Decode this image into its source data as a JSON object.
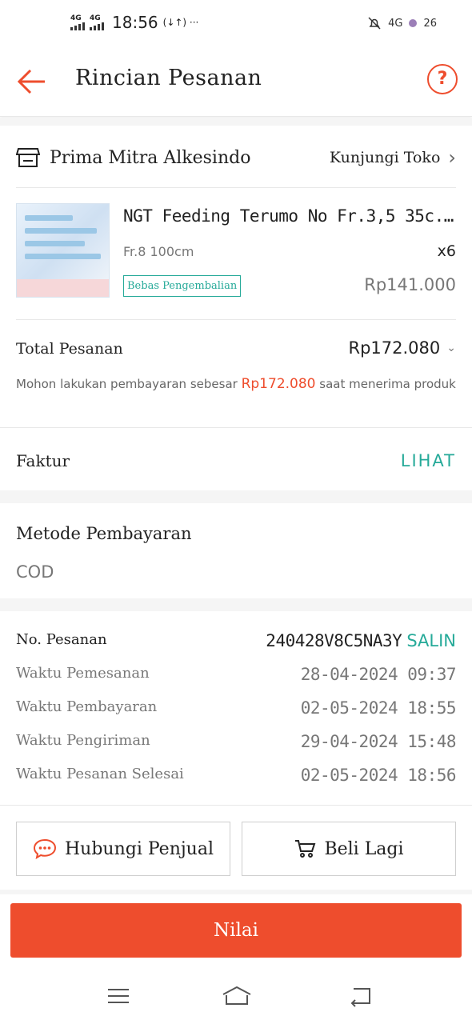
{
  "status_bar": {
    "network_1": "4G",
    "network_2": "4G",
    "time": "18:56",
    "extra": "(↓↑) ···",
    "network_3": "4G",
    "battery": "26"
  },
  "header": {
    "title": "Rincian Pesanan",
    "help": "?"
  },
  "shop": {
    "name": "Prima Mitra Alkesindo",
    "visit_label": "Kunjungi Toko"
  },
  "product": {
    "name": "NGT Feeding Terumo No Fr.3,5 35c...",
    "variant": "Fr.8 100cm",
    "qty": "x6",
    "badge": "Bebas Pengembalian",
    "price": "Rp141.000"
  },
  "total": {
    "label": "Total Pesanan",
    "value": "Rp172.080",
    "note_prefix": "Mohon lakukan pembayaran sebesar ",
    "note_amount": "Rp172.080",
    "note_suffix": " saat menerima produk"
  },
  "invoice": {
    "label": "Faktur",
    "link": "LIHAT"
  },
  "payment": {
    "label": "Metode Pembayaran",
    "value": "COD"
  },
  "order": {
    "number_label": "No. Pesanan",
    "number": "240428V8C5NA3Y",
    "copy": "SALIN",
    "rows": [
      {
        "label": "Waktu Pemesanan",
        "value": "28-04-2024 09:37"
      },
      {
        "label": "Waktu Pembayaran",
        "value": "02-05-2024 18:55"
      },
      {
        "label": "Waktu Pengiriman",
        "value": "29-04-2024 15:48"
      },
      {
        "label": "Waktu Pesanan Selesai",
        "value": "02-05-2024 18:56"
      }
    ]
  },
  "actions": {
    "chat_label": "Hubungi Penjual",
    "buy_again_label": "Beli Lagi",
    "rate_label": "Nilai"
  },
  "colors": {
    "accent": "#ee4d2d",
    "teal": "#26aa99",
    "chat_icon": "#ee4d2d"
  },
  "icons": {
    "back": "arrow-left-icon",
    "help": "question-circle-icon",
    "shop": "store-icon",
    "chat": "chat-bubble-icon",
    "cart": "cart-icon",
    "nav_menu": "menu-icon",
    "nav_home": "home-icon",
    "nav_back": "back-icon"
  }
}
